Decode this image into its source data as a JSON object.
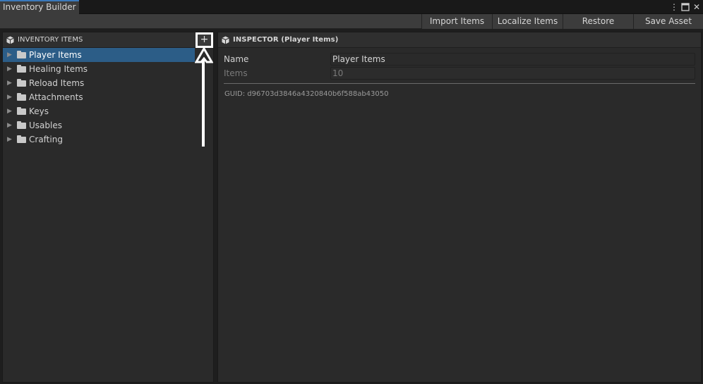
{
  "window": {
    "tab_title": "Inventory Builder",
    "menu_icon": "kebab-menu-icon",
    "maximize_icon": "maximize-icon",
    "close_icon": "close-icon"
  },
  "toolbar": {
    "import_label": "Import Items",
    "localize_label": "Localize Items",
    "restore_label": "Restore",
    "save_label": "Save Asset"
  },
  "inventory_panel": {
    "title": "INVENTORY ITEMS",
    "header_icon": "cube-icon",
    "add_label": "+",
    "items": [
      {
        "label": "Player Items",
        "selected": true
      },
      {
        "label": "Healing Items",
        "selected": false
      },
      {
        "label": "Reload Items",
        "selected": false
      },
      {
        "label": "Attachments",
        "selected": false
      },
      {
        "label": "Keys",
        "selected": false
      },
      {
        "label": "Usables",
        "selected": false
      },
      {
        "label": "Crafting",
        "selected": false
      }
    ]
  },
  "inspector": {
    "title": "INSPECTOR (Player Items)",
    "header_icon": "cube-icon",
    "name_label": "Name",
    "name_value": "Player Items",
    "items_label": "Items",
    "items_value": "10",
    "guid": "GUID: d96703d3846a4320840b6f588ab43050"
  },
  "colors": {
    "selection": "#2c5d87",
    "tab_accent": "#3a79bb",
    "highlight": "#ffffff"
  }
}
